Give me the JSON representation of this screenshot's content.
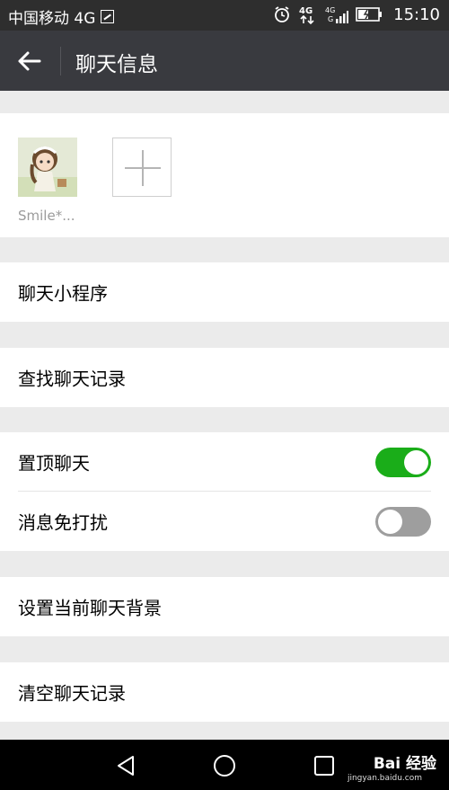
{
  "status_bar": {
    "carrier": "中国移动 4G",
    "network_label": "4G",
    "time": "15:10"
  },
  "header": {
    "title": "聊天信息"
  },
  "members": [
    {
      "name": "Smile*..."
    }
  ],
  "rows": {
    "mini_programs": "聊天小程序",
    "search_history": "查找聊天记录",
    "pin_chat": "置顶聊天",
    "mute": "消息免打扰",
    "set_background": "设置当前聊天背景",
    "clear_history": "清空聊天记录"
  },
  "toggles": {
    "pin_chat_on": true,
    "mute_on": false
  },
  "watermark": {
    "brand": "Bai 经验",
    "url": "jingyan.baidu.com"
  },
  "colors": {
    "accent": "#1aad19",
    "header_bg": "#393a3f",
    "page_bg": "#ebebeb"
  }
}
